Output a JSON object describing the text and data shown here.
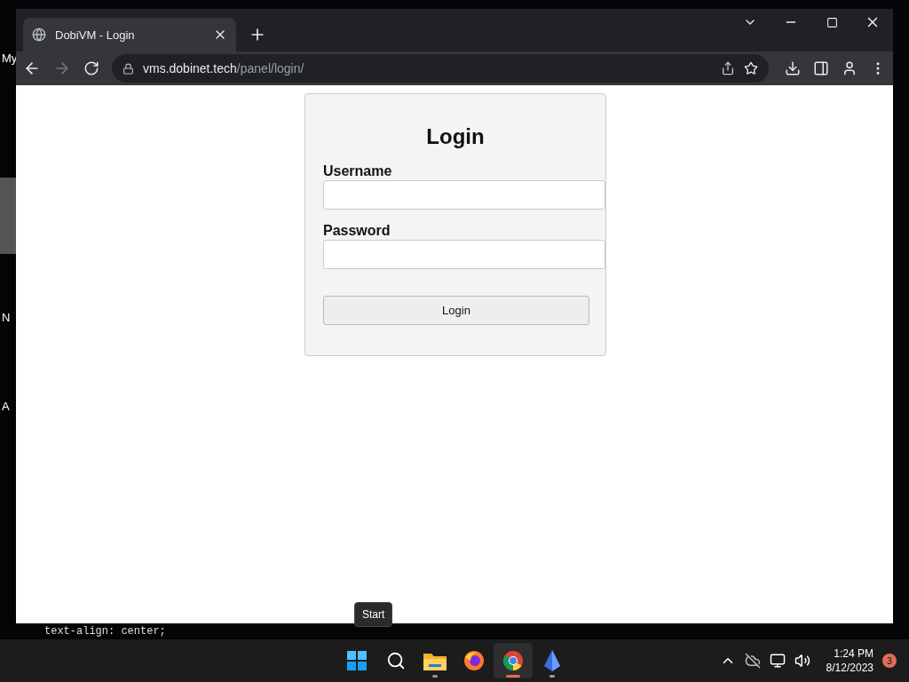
{
  "desktop": {
    "labels": [
      "My",
      "N",
      "A"
    ],
    "code_line": "text-align: center;"
  },
  "browser": {
    "tab": {
      "title": "DobiVM - Login"
    },
    "url": {
      "host": "vms.dobinet.tech",
      "path": "/panel/login/"
    }
  },
  "login": {
    "title": "Login",
    "fields": [
      {
        "label": "Username"
      },
      {
        "label": "Password"
      }
    ],
    "button": "Login"
  },
  "tooltip": "Start",
  "taskbar": {
    "apps": [
      {
        "kind": "start",
        "selected": false,
        "running": false
      },
      {
        "kind": "search",
        "selected": false,
        "running": false
      },
      {
        "kind": "folder",
        "selected": false,
        "running": true
      },
      {
        "kind": "firefox",
        "selected": false,
        "running": false
      },
      {
        "kind": "chrome",
        "selected": true,
        "running": true
      },
      {
        "kind": "crystal",
        "selected": false,
        "running": true
      }
    ],
    "time": "1:24 PM",
    "date": "8/12/2023",
    "badge": "3"
  }
}
